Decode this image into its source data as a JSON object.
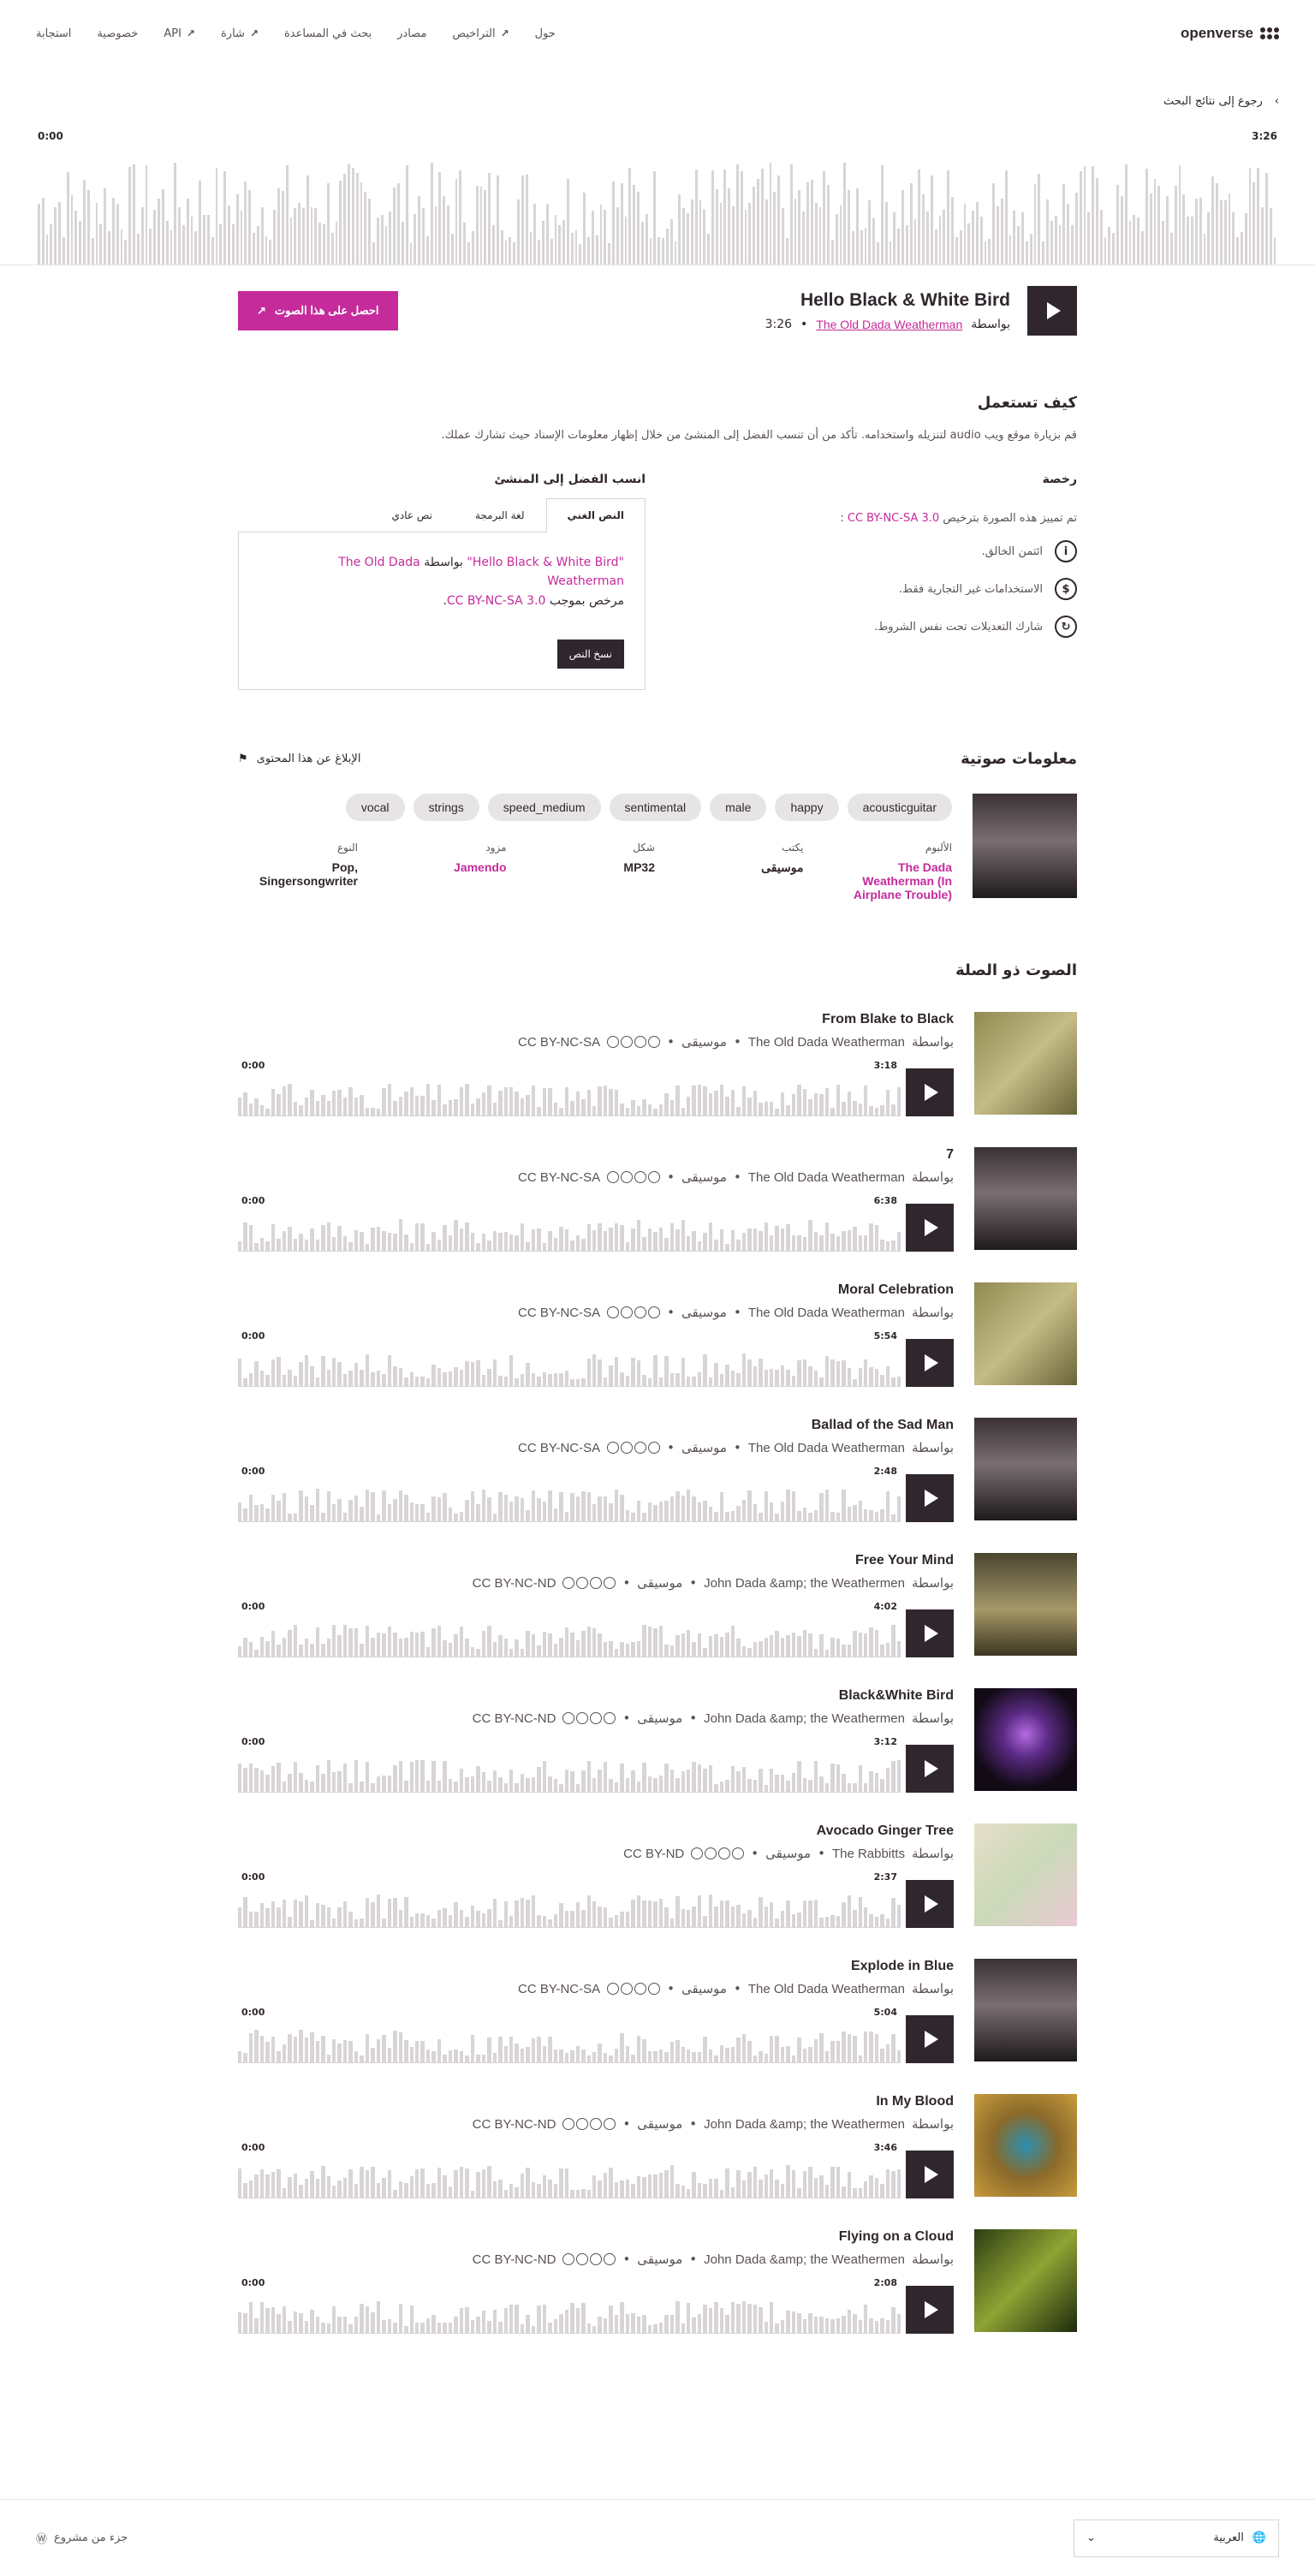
{
  "brand": {
    "name": "openverse"
  },
  "nav": [
    {
      "label": "حول"
    },
    {
      "label": "التراخيص"
    },
    {
      "label": "مصادر"
    },
    {
      "label": "بحث في المساعدة"
    },
    {
      "label": "شارة"
    },
    {
      "label": "API"
    },
    {
      "label": "خصوصية"
    },
    {
      "label": "استجابة"
    }
  ],
  "back_link": "رجوع إلى نتائج البحث",
  "player": {
    "start": "0:00",
    "end": "3:26",
    "title": "Hello Black & White Bird",
    "by": "بواسطة",
    "artist": "The Old Dada Weatherman",
    "duration": "3:26",
    "download": "احصل على هذا الصوت"
  },
  "howto": {
    "title": "كيف تستعمل",
    "text": "قم بزيارة موقع ويب audio لتنزيله واستخدامه. تأكد من أن تنسب الفضل إلى المنشئ من خلال إظهار معلومات الإسناد حيث تشارك عملك."
  },
  "license": {
    "title": "رخصة",
    "text": "تم تمييز هذه الصورة بترخيص",
    "name": "CC BY-NC-SA 3.0",
    "rows": [
      {
        "icon": "by-icon",
        "text": "ائتمن الخالق."
      },
      {
        "icon": "nc-icon",
        "text": "الاستخدامات غير التجارية فقط."
      },
      {
        "icon": "sa-icon",
        "text": "شارك التعديلات تحت نفس الشروط."
      }
    ]
  },
  "attribution": {
    "title": "انسب الفضل إلى المنشئ",
    "tabs": [
      "النص الغني",
      "لغة البرمجة",
      "نص عادي"
    ],
    "work": "\"Hello Black & White Bird\"",
    "by": "بواسطة",
    "creator": "The Old Dada Weatherman",
    "licensed": "مرخص بموجب",
    "license": "CC BY-NC-SA 3.0",
    "copy": "نسخ النص"
  },
  "info": {
    "title": "معلومات صوتية",
    "report": "الإبلاغ عن هذا المحتوى",
    "tags": [
      "acousticguitar",
      "happy",
      "male",
      "sentimental",
      "speed_medium",
      "strings",
      "vocal"
    ],
    "meta": [
      {
        "key": "الألبوم",
        "value": "The Dada Weatherman (In Airplane Trouble)",
        "link": true
      },
      {
        "key": "يكتب",
        "value": "موسيقى",
        "link": false
      },
      {
        "key": "شكل",
        "value": "MP32",
        "link": false
      },
      {
        "key": "مزود",
        "value": "Jamendo",
        "link": true
      },
      {
        "key": "النوع",
        "value": "Pop, Singersongwriter",
        "link": false
      }
    ]
  },
  "related": {
    "title": "الصوت ذو الصلة",
    "by": "بواسطة",
    "category": "موسيقى",
    "start": "0:00",
    "items": [
      {
        "title": "From Blake to Black",
        "artist": "The Old Dada Weatherman",
        "license": "CC BY-NC-SA",
        "duration": "3:18",
        "cover": "portraits"
      },
      {
        "title": "7",
        "artist": "The Old Dada Weatherman",
        "license": "CC BY-NC-SA",
        "duration": "6:38",
        "cover": "stripes"
      },
      {
        "title": "Moral Celebration",
        "artist": "The Old Dada Weatherman",
        "license": "CC BY-NC-SA",
        "duration": "5:54",
        "cover": "portraits"
      },
      {
        "title": "Ballad of the Sad Man",
        "artist": "The Old Dada Weatherman",
        "license": "CC BY-NC-SA",
        "duration": "2:48",
        "cover": "stripes"
      },
      {
        "title": "Free Your Mind",
        "artist": "John Dada &amp; the Weathermen",
        "license": "CC BY-NC-ND",
        "duration": "4:02",
        "cover": "field"
      },
      {
        "title": "Black&White Bird",
        "artist": "John Dada &amp; the Weathermen",
        "license": "CC BY-NC-ND",
        "duration": "3:12",
        "cover": "flower"
      },
      {
        "title": "Avocado Ginger Tree",
        "artist": "The Rabbitts",
        "license": "CC BY-ND",
        "duration": "2:37",
        "cover": "drawing"
      },
      {
        "title": "Explode in Blue",
        "artist": "The Old Dada Weatherman",
        "license": "CC BY-NC-SA",
        "duration": "5:04",
        "cover": "stripes"
      },
      {
        "title": "In My Blood",
        "artist": "John Dada &amp; the Weathermen",
        "license": "CC BY-NC-ND",
        "duration": "3:46",
        "cover": "bird"
      },
      {
        "title": "Flying on a Cloud",
        "artist": "John Dada &amp; the Weathermen",
        "license": "CC BY-NC-ND",
        "duration": "2:08",
        "cover": "green"
      }
    ]
  },
  "footer": {
    "language": "العربية",
    "wordpress": "جزء من مشروع"
  },
  "colors": {
    "accent": "#c52b9b",
    "dark": "#30272e",
    "wave": "#d8d4d7"
  }
}
